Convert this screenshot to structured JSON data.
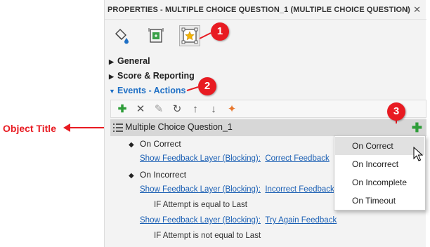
{
  "panel": {
    "title": "PROPERTIES - MULTIPLE CHOICE QUESTION_1 (MULTIPLE CHOICE QUESTION)",
    "pin_glyph": "⊣",
    "close_glyph": "✕"
  },
  "icon_tabs": [
    {
      "icon": "paint-bucket-icon"
    },
    {
      "icon": "size-position-icon"
    },
    {
      "icon": "star-frame-icon",
      "active": true
    }
  ],
  "sections": {
    "general": "General",
    "score": "Score & Reporting",
    "events": "Events - Actions"
  },
  "toolbar": {
    "add": "✚",
    "delete": "✕",
    "edit": "✎",
    "undo": "↻",
    "up": "↑",
    "down": "↓",
    "magic": "✦"
  },
  "object_row": {
    "title": "Multiple Choice Question_1",
    "add_glyph": "✚"
  },
  "events": [
    {
      "name": "On Correct"
    },
    {
      "name": "On Incorrect"
    }
  ],
  "actions": [
    {
      "verb": "Show Feedback Layer (Blocking):",
      "target": "Correct Feedback"
    },
    {
      "verb": "Show Feedback Layer (Blocking):",
      "target": "Incorrect Feedback"
    },
    {
      "verb": "Show Feedback Layer (Blocking):",
      "target": "Try Again Feedback"
    }
  ],
  "conditions": [
    "IF Attempt is equal to Last",
    "IF Attempt is not equal to Last"
  ],
  "dropdown": {
    "items": [
      "On Correct",
      "On Incorrect",
      "On Incomplete",
      "On Timeout"
    ],
    "selected": "On Correct"
  },
  "annotations": {
    "badge1": "1",
    "badge2": "2",
    "badge3": "3",
    "object_title_label": "Object Title",
    "color": "#e81b22"
  },
  "colors": {
    "link": "#1a5fb4",
    "add_green": "#2e9d39",
    "accent_blue": "#1e6fc5"
  }
}
